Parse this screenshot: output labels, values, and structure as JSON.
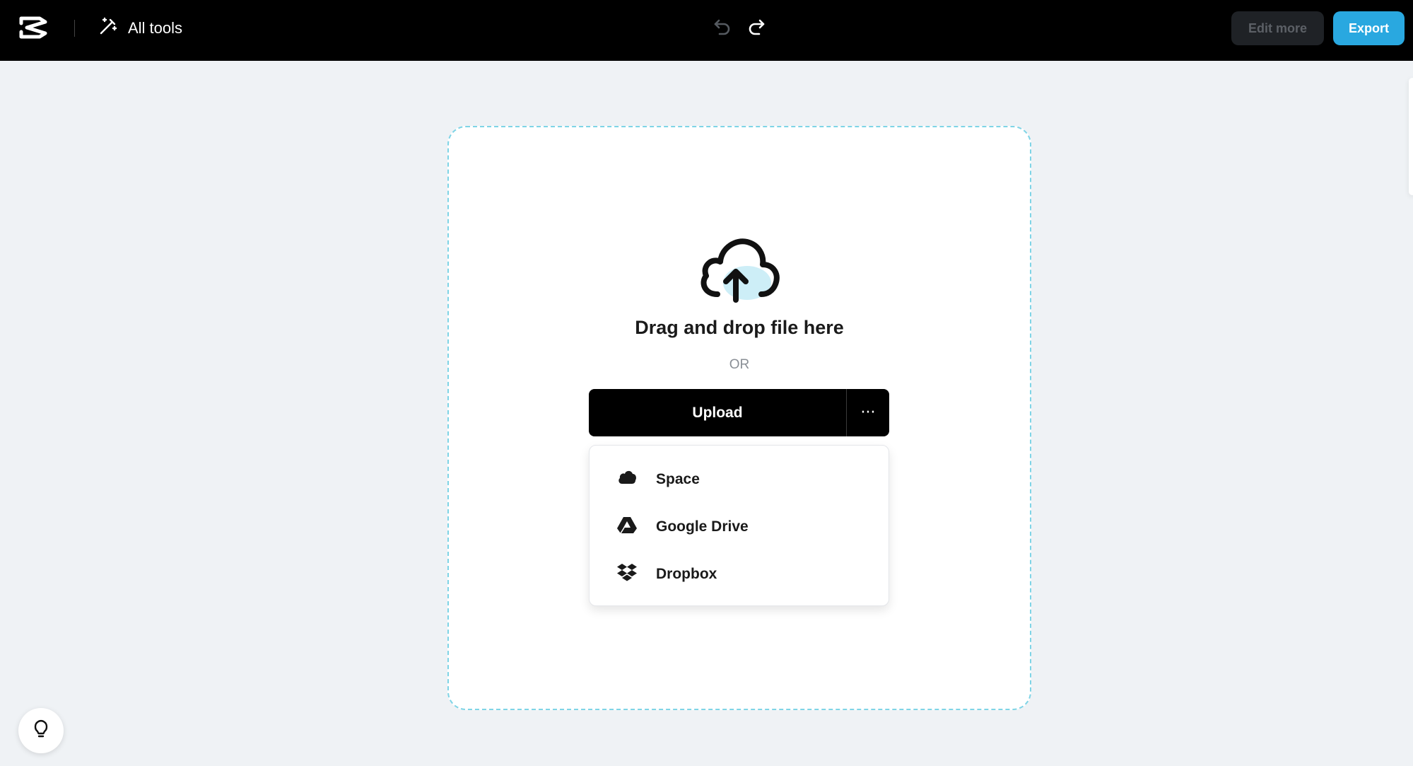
{
  "header": {
    "logo_icon": "capcut-logo-icon",
    "all_tools_label": "All tools",
    "all_tools_icon": "magic-wand-icon",
    "undo_icon": "undo-icon",
    "redo_icon": "redo-icon",
    "edit_more_label": "Edit more",
    "export_label": "Export"
  },
  "dropzone": {
    "icon": "cloud-upload-icon",
    "title": "Drag and drop file here",
    "or_label": "OR",
    "upload_label": "Upload",
    "more_label": "···"
  },
  "upload_menu": {
    "items": [
      {
        "label": "Space",
        "icon": "cloud-icon"
      },
      {
        "label": "Google Drive",
        "icon": "google-drive-icon"
      },
      {
        "label": "Dropbox",
        "icon": "dropbox-icon"
      }
    ]
  },
  "hint_icon": "lightbulb-icon",
  "colors": {
    "accent": "#29a8e0",
    "dropzone_border": "#7fd4e6",
    "topbar": "#000000",
    "background": "#eff2f5"
  }
}
